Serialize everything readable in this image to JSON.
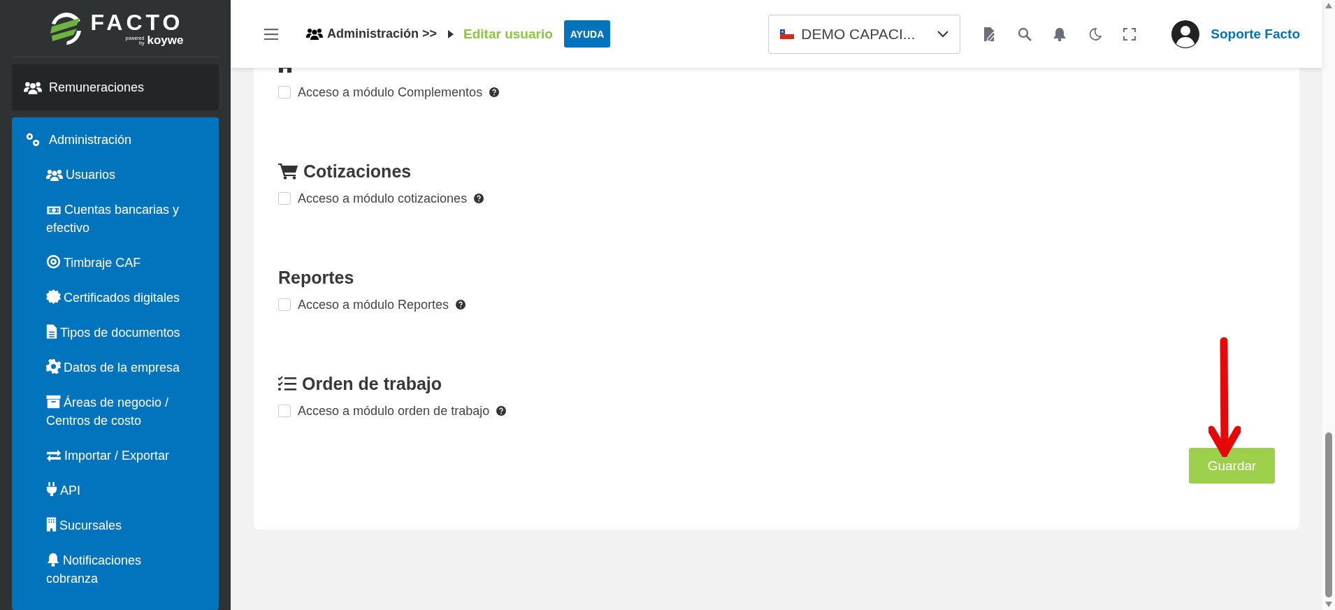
{
  "logo": {
    "brand": "FACTO",
    "powered": "powered",
    "by": "by",
    "partner": "koywe"
  },
  "sidebar": {
    "sections": [
      {
        "label": "Remuneraciones",
        "expanded": false
      },
      {
        "label": "Administración",
        "expanded": true,
        "children": [
          {
            "label": "Usuarios"
          },
          {
            "label": "Cuentas bancarias y efectivo"
          },
          {
            "label": "Timbraje CAF"
          },
          {
            "label": "Certificados digitales"
          },
          {
            "label": "Tipos de documentos"
          },
          {
            "label": "Datos de la empresa"
          },
          {
            "label": "Áreas de negocio / Centros de costo"
          },
          {
            "label": "Importar / Exportar"
          },
          {
            "label": "API"
          },
          {
            "label": "Sucursales"
          },
          {
            "label": "Notificaciones cobranza"
          }
        ]
      }
    ]
  },
  "header": {
    "breadcrumb": [
      {
        "label": "Administración >>",
        "current": false
      },
      {
        "label": "Editar usuario",
        "current": true
      }
    ],
    "help_button": "AYUDA",
    "company_select": {
      "value": "DEMO CAPACI..."
    },
    "user": "Soporte Facto"
  },
  "sections": [
    {
      "option": "Acceso a módulo Complementos",
      "checked": false
    },
    {
      "title": "Cotizaciones",
      "option": "Acceso a módulo cotizaciones",
      "checked": false
    },
    {
      "title": "Reportes",
      "option": "Acceso a módulo Reportes",
      "checked": false
    },
    {
      "title": "Orden de trabajo",
      "option": "Acceso a módulo orden de trabajo",
      "checked": false
    }
  ],
  "save_button": "Guardar"
}
